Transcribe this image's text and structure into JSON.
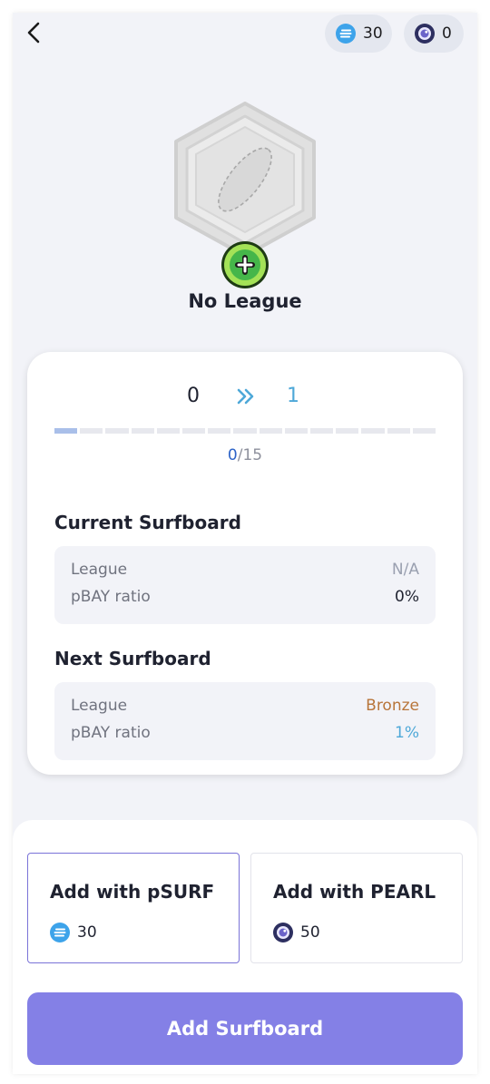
{
  "header": {
    "psurf_balance": "30",
    "pearl_balance": "0",
    "icons": {
      "back": "chevron-left-icon",
      "psurf": "psurf-coin-icon",
      "pearl": "pearl-coin-icon"
    }
  },
  "badge": {
    "icon": "surfboard-hexagon-icon",
    "add_icon": "plus-circle-icon",
    "league_name": "No League"
  },
  "progress": {
    "from_level": "0",
    "to_level": "1",
    "current": "0",
    "total": "/15",
    "fraction": 0.0667,
    "segments": 15,
    "filled_segments": 1
  },
  "current_surfboard": {
    "title": "Current Surfboard",
    "rows": [
      {
        "label": "League",
        "value": "N/A"
      },
      {
        "label": "pBAY ratio",
        "value": "0%"
      }
    ]
  },
  "next_surfboard": {
    "title": "Next Surfboard",
    "rows": [
      {
        "label": "League",
        "value": "Bronze"
      },
      {
        "label": "pBAY ratio",
        "value": "1%"
      }
    ]
  },
  "purchase": {
    "options": [
      {
        "title": "Add with pSURF",
        "price": "30",
        "selected": true
      },
      {
        "title": "Add with PEARL",
        "price": "50",
        "selected": false
      }
    ],
    "cta_label": "Add Surfboard"
  },
  "colors": {
    "accent": "#8480e6",
    "selected_border": "#7a73d8",
    "psurf": "#3da3ea",
    "pearl": "#2d2f60",
    "bronze": "#b8753a",
    "next_level": "#4ea8d8",
    "progress_current": "#2d63c8"
  }
}
